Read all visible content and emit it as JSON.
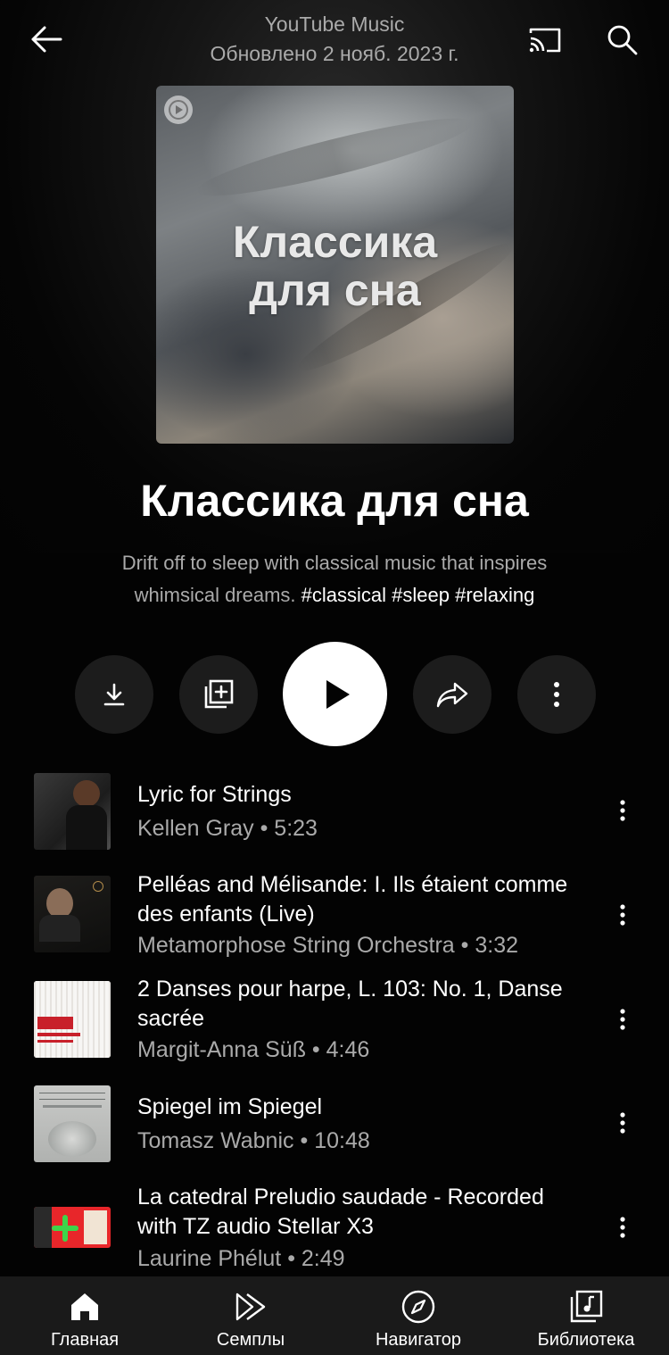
{
  "header": {
    "title": "YouTube Music",
    "subtitle": "Обновлено 2 нояб. 2023 г."
  },
  "cover": {
    "text_line1": "Классика",
    "text_line2": "для сна"
  },
  "playlist": {
    "title": "Классика для сна",
    "description": "Drift off to sleep with classical music that inspires whimsical dreams.",
    "tags": "#classical #sleep #relaxing"
  },
  "actions": {
    "download_icon": "download-icon",
    "add_icon": "library-add-icon",
    "play_icon": "play-icon",
    "share_icon": "share-icon",
    "more_icon": "more-vert-icon"
  },
  "tracks": [
    {
      "title": "Lyric for Strings",
      "artist": "Kellen Gray",
      "duration": "5:23"
    },
    {
      "title": "Pelléas and Mélisande: I. Ils étaient comme des enfants (Live)",
      "artist": "Metamorphose String Orchestra",
      "duration": "3:32"
    },
    {
      "title": "2 Danses pour harpe, L. 103: No. 1, Danse sacrée",
      "artist": "Margit-Anna Süß",
      "duration": "4:46"
    },
    {
      "title": "Spiegel im Spiegel",
      "artist": "Tomasz Wabnic",
      "duration": "10:48"
    },
    {
      "title": "La catedral Preludio saudade - Recorded with TZ audio Stellar X3",
      "artist": "Laurine Phélut",
      "duration": "2:49"
    }
  ],
  "separator": "•",
  "nav": [
    {
      "label": "Главная",
      "icon": "home-icon",
      "active": true
    },
    {
      "label": "Семплы",
      "icon": "samples-icon",
      "active": false
    },
    {
      "label": "Навигатор",
      "icon": "explore-icon",
      "active": false
    },
    {
      "label": "Библиотека",
      "icon": "library-icon",
      "active": false
    }
  ],
  "colors": {
    "background": "#030303",
    "secondary_text": "#aaaaaa",
    "nav_background": "#1a1a1a"
  }
}
